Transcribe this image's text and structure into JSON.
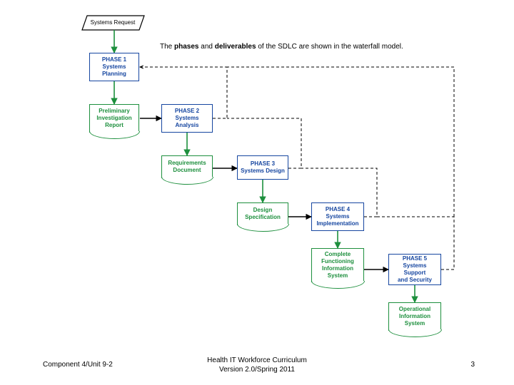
{
  "caption_html": "The <b>phases</b> and <b>deliverables</b> of the SDLC are shown in the waterfall model.",
  "start": {
    "label": "Systems Request"
  },
  "phases": [
    {
      "key": "p1",
      "label": "PHASE 1\nSystems\nPlanning"
    },
    {
      "key": "p2",
      "label": "PHASE 2\nSystems\nAnalysis"
    },
    {
      "key": "p3",
      "label": "PHASE 3\nSystems Design"
    },
    {
      "key": "p4",
      "label": "PHASE 4\nSystems\nImplementation"
    },
    {
      "key": "p5",
      "label": "PHASE 5\nSystems Support\nand Security"
    }
  ],
  "deliverables": [
    {
      "key": "d1",
      "label": "Preliminary\nInvestigation\nReport"
    },
    {
      "key": "d2",
      "label": "Requirements\nDocument"
    },
    {
      "key": "d3",
      "label": "Design\nSpecification"
    },
    {
      "key": "d4",
      "label": "Complete\nFunctioning\nInformation\nSystem"
    },
    {
      "key": "d5",
      "label": "Operational\nInformation\nSystem"
    }
  ],
  "footer": {
    "left": "Component 4/Unit 9-2",
    "center_line1": "Health IT Workforce Curriculum",
    "center_line2": "Version 2.0/Spring 2011",
    "right": "3"
  },
  "colors": {
    "phase": "#1646a0",
    "deliv": "#1d8f3d"
  }
}
